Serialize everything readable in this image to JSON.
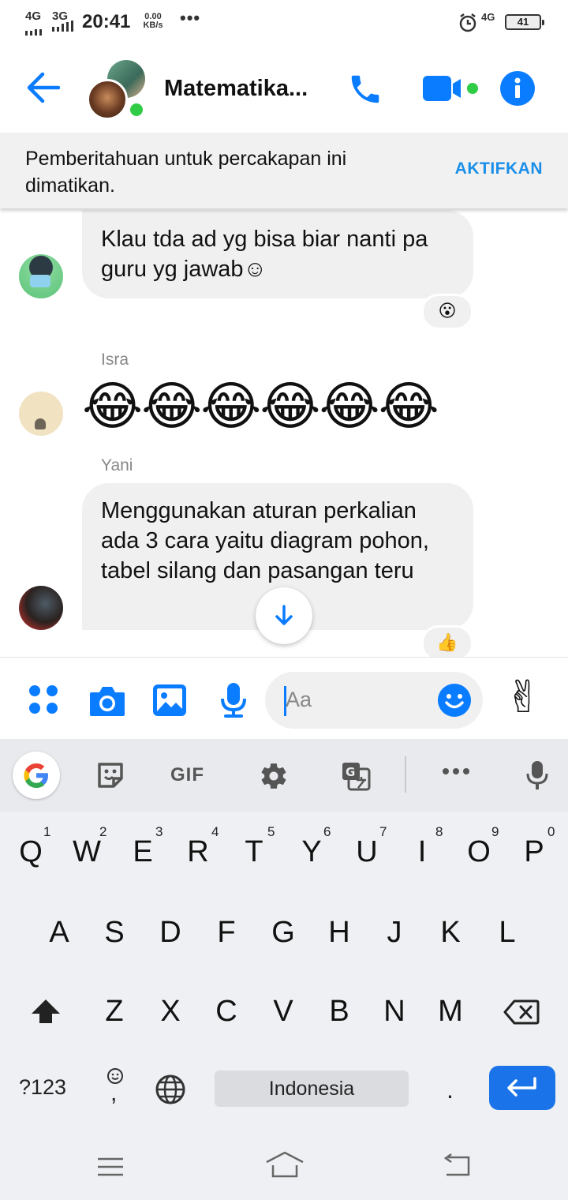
{
  "status_bar": {
    "network1": "4G",
    "network2": "3G",
    "time": "20:41",
    "speed_value": "0.00",
    "speed_unit": "KB/s",
    "more": "•••",
    "network3": "4G",
    "battery": "41"
  },
  "header": {
    "title": "Matematika...",
    "colors": {
      "accent": "#0a7cff",
      "online": "#31cc46"
    }
  },
  "banner": {
    "text": "Pemberitahuan untuk percakapan ini dimatikan.",
    "action": "AKTIFKAN"
  },
  "messages": [
    {
      "sender": "",
      "text": "Klau tda ad yg bisa biar nanti pa guru yg jawab☺",
      "reaction": "😮"
    },
    {
      "sender": "Isra",
      "text": "😂😂😂😂😂😂"
    },
    {
      "sender": "Yani",
      "text": "Menggunakan aturan perkalian ada 3 cara yaitu diagram pohon, tabel silang dan pasangan teru",
      "reaction": "👍"
    }
  ],
  "composer": {
    "placeholder": "Aa",
    "quick_reaction": "✌"
  },
  "keyboard": {
    "toolbar": {
      "gif": "GIF"
    },
    "row1": [
      "Q",
      "W",
      "E",
      "R",
      "T",
      "Y",
      "U",
      "I",
      "O",
      "P"
    ],
    "row1_hints": [
      "1",
      "2",
      "3",
      "4",
      "5",
      "6",
      "7",
      "8",
      "9",
      "0"
    ],
    "row2": [
      "A",
      "S",
      "D",
      "F",
      "G",
      "H",
      "J",
      "K",
      "L"
    ],
    "row3": [
      "Z",
      "X",
      "C",
      "V",
      "B",
      "N",
      "M"
    ],
    "symbols_key": "?123",
    "comma": ",",
    "space_label": "Indonesia",
    "period": "."
  }
}
